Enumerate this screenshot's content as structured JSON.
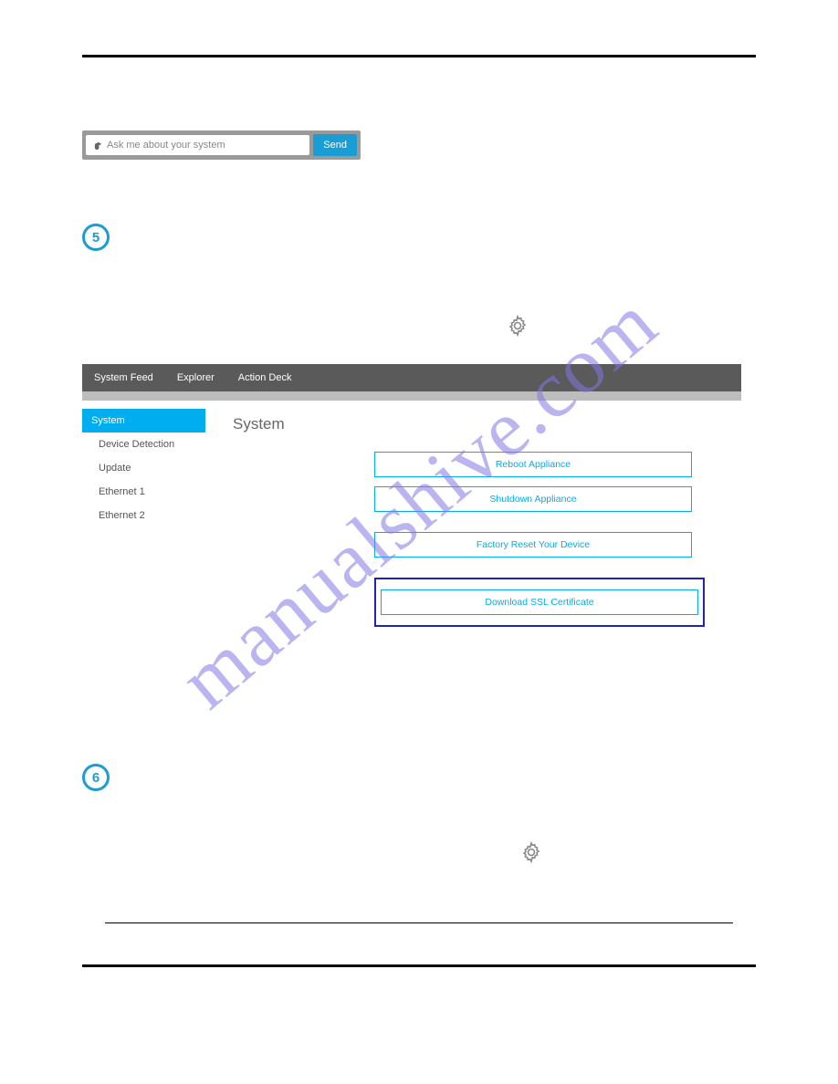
{
  "watermark_text": "manualshive.com",
  "search": {
    "placeholder": "Ask me about your system",
    "button_label": "Send"
  },
  "steps": {
    "five": "5",
    "six": "6"
  },
  "topbar": {
    "items": [
      "System Feed",
      "Explorer",
      "Action Deck"
    ]
  },
  "sidebar": {
    "items": [
      {
        "label": "System",
        "active": true,
        "sub": false
      },
      {
        "label": "Device Detection",
        "active": false,
        "sub": true
      },
      {
        "label": "Update",
        "active": false,
        "sub": true
      },
      {
        "label": "Ethernet 1",
        "active": false,
        "sub": true
      },
      {
        "label": "Ethernet 2",
        "active": false,
        "sub": true
      }
    ]
  },
  "main": {
    "title": "System",
    "buttons": {
      "reboot": "Reboot Appliance",
      "shutdown": "Shutdown Appliance",
      "factory_reset": "Factory Reset Your Device",
      "download_ssl": "Download SSL Certificate"
    }
  }
}
